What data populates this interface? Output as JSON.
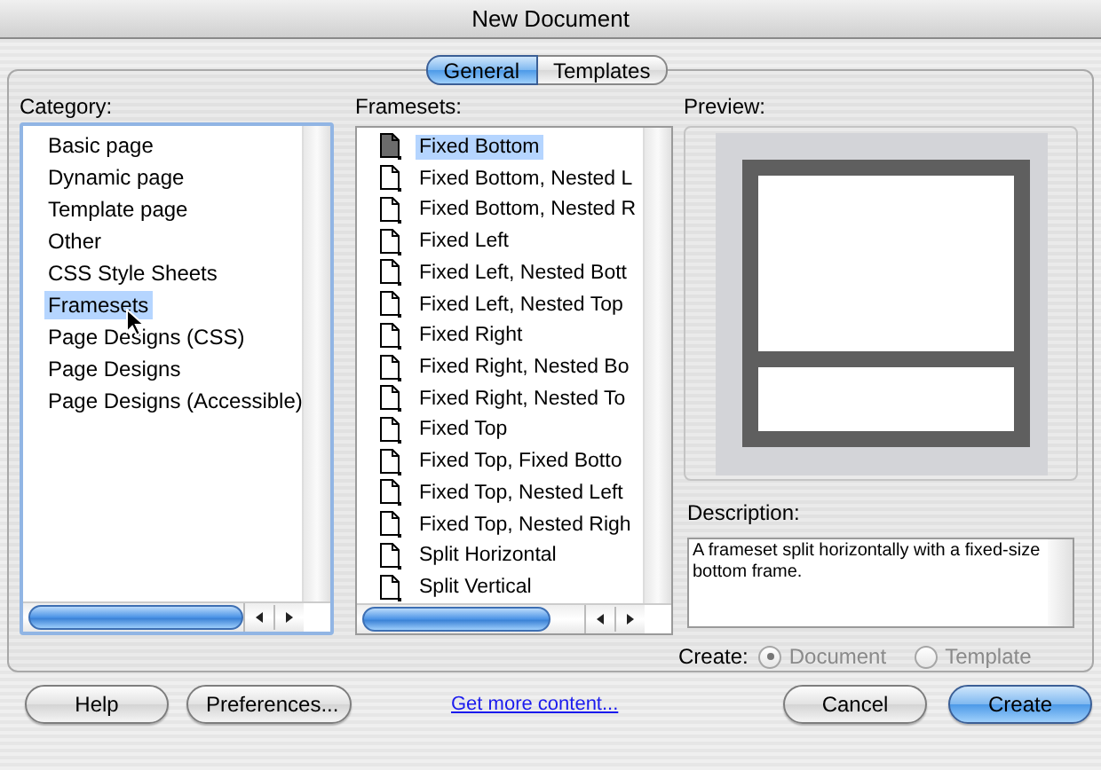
{
  "window": {
    "title": "New Document"
  },
  "tabs": [
    {
      "label": "General",
      "selected": true
    },
    {
      "label": "Templates",
      "selected": false
    }
  ],
  "category": {
    "label": "Category:",
    "items": [
      {
        "label": "Basic page",
        "selected": false
      },
      {
        "label": "Dynamic page",
        "selected": false
      },
      {
        "label": "Template page",
        "selected": false
      },
      {
        "label": "Other",
        "selected": false
      },
      {
        "label": "CSS Style Sheets",
        "selected": false
      },
      {
        "label": "Framesets",
        "selected": true
      },
      {
        "label": "Page Designs (CSS)",
        "selected": false
      },
      {
        "label": "Page Designs",
        "selected": false
      },
      {
        "label": "Page Designs (Accessible)",
        "selected": false
      }
    ]
  },
  "framesets": {
    "label": "Framesets:",
    "items": [
      {
        "label": "Fixed Bottom",
        "selected": true
      },
      {
        "label": "Fixed Bottom, Nested L",
        "selected": false
      },
      {
        "label": "Fixed Bottom, Nested R",
        "selected": false
      },
      {
        "label": "Fixed Left",
        "selected": false
      },
      {
        "label": "Fixed Left, Nested Bott",
        "selected": false
      },
      {
        "label": "Fixed Left, Nested Top",
        "selected": false
      },
      {
        "label": "Fixed Right",
        "selected": false
      },
      {
        "label": "Fixed Right, Nested Bo",
        "selected": false
      },
      {
        "label": "Fixed Right, Nested To",
        "selected": false
      },
      {
        "label": "Fixed Top",
        "selected": false
      },
      {
        "label": "Fixed Top, Fixed Botto",
        "selected": false
      },
      {
        "label": "Fixed Top, Nested Left",
        "selected": false
      },
      {
        "label": "Fixed Top, Nested Righ",
        "selected": false
      },
      {
        "label": "Split Horizontal",
        "selected": false
      },
      {
        "label": "Split Vertical",
        "selected": false
      }
    ]
  },
  "preview": {
    "label": "Preview:"
  },
  "description": {
    "label": "Description:",
    "text": "A frameset split horizontally with a fixed-size bottom frame."
  },
  "create": {
    "label": "Create:",
    "options": [
      {
        "label": "Document",
        "selected": true,
        "disabled": true
      },
      {
        "label": "Template",
        "selected": false,
        "disabled": true
      }
    ]
  },
  "footer": {
    "left_buttons": [
      {
        "label": "Help",
        "kind": "normal"
      },
      {
        "label": "Preferences...",
        "kind": "normal"
      }
    ],
    "link": "Get more content...",
    "right_buttons": [
      {
        "label": "Cancel",
        "kind": "normal"
      },
      {
        "label": "Create",
        "kind": "default"
      }
    ]
  }
}
